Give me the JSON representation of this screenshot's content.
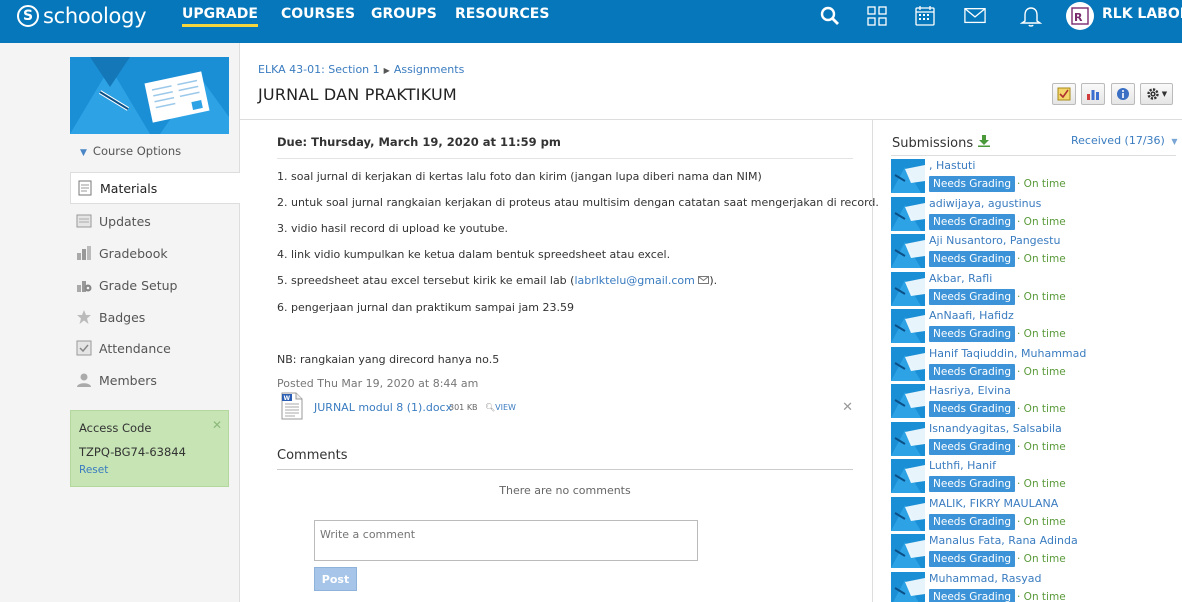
{
  "app": {
    "logo_text": "schoology",
    "logo_glyph": "S"
  },
  "nav": {
    "upgrade": "UPGRADE",
    "courses": "COURSES",
    "groups": "GROUPS",
    "resources": "RESOURCES",
    "user_name": "RLK LABORA"
  },
  "topbar_icons": [
    "search-icon",
    "apps-grid-icon",
    "calendar-icon",
    "mail-icon",
    "notifications-icon",
    "user-avatar"
  ],
  "sidebar": {
    "course_options": "Course Options",
    "items": [
      {
        "label": "Materials",
        "icon": "materials-icon"
      },
      {
        "label": "Updates",
        "icon": "updates-icon"
      },
      {
        "label": "Gradebook",
        "icon": "gradebook-icon"
      },
      {
        "label": "Grade Setup",
        "icon": "grade-setup-icon"
      },
      {
        "label": "Badges",
        "icon": "badges-icon"
      },
      {
        "label": "Attendance",
        "icon": "attendance-icon"
      },
      {
        "label": "Members",
        "icon": "members-icon"
      }
    ],
    "access": {
      "title": "Access Code",
      "code": "TZPQ-BG74-63844",
      "reset": "Reset"
    }
  },
  "breadcrumb": {
    "course": "ELKA 43-01: Section 1",
    "section": "Assignments"
  },
  "page": {
    "title": "JURNAL DAN PRAKTIKUM"
  },
  "assignment": {
    "due": "Due: Thursday, March 19, 2020 at 11:59 pm",
    "lines": [
      "1. soal jurnal di kerjakan di kertas lalu foto dan kirim (jangan lupa diberi nama dan NIM)",
      "2. untuk soal jurnal rangkaian kerjakan di proteus atau multisim dengan catatan saat mengerjakan di record.",
      "3. vidio hasil record di upload ke youtube.",
      "4. link vidio kumpulkan ke ketua dalam bentuk spreedsheet atau excel.",
      "5. spreedsheet atau excel tersebut kirik ke email lab (",
      "6. pengerjaan jurnal dan praktikum sampai jam 23.59"
    ],
    "email": "labrlktelu@gmail.com",
    "email_suffix": ").",
    "note": "NB: rangkaian yang direcord hanya no.5",
    "posted": "Posted Thu Mar 19, 2020 at 8:44 am",
    "attachment": {
      "name": "JURNAL modul 8 (1).docx",
      "size": "301 KB",
      "view": "VIEW"
    }
  },
  "comments": {
    "title": "Comments",
    "empty": "There are no comments",
    "placeholder": "Write a comment",
    "post": "Post"
  },
  "submissions": {
    "title": "Submissions",
    "received": "Received (17/36)",
    "status": "Needs Grading",
    "ontime": "· On time",
    "students": [
      ", Hastuti",
      "adiwijaya, agustinus",
      "Aji Nusantoro, Pangestu",
      "Akbar, Rafli",
      "AnNaafi, Hafidz",
      "Hanif Taqiuddin, Muhammad",
      "Hasriya, Elvina",
      "Isnandyagitas, Salsabila",
      "Luthfi, Hanif",
      "MALIK, FIKRY MAULANA",
      "Manalus Fata, Rana Adinda",
      "Muhammad, Rasyad"
    ]
  },
  "colors": {
    "topbar": "#0677ba",
    "accent_underline": "#f5d63d",
    "link": "#3a7cc0",
    "badge": "#3c93d8",
    "ontime": "#5a9a3a",
    "access_bg": "#c6e4b4"
  }
}
